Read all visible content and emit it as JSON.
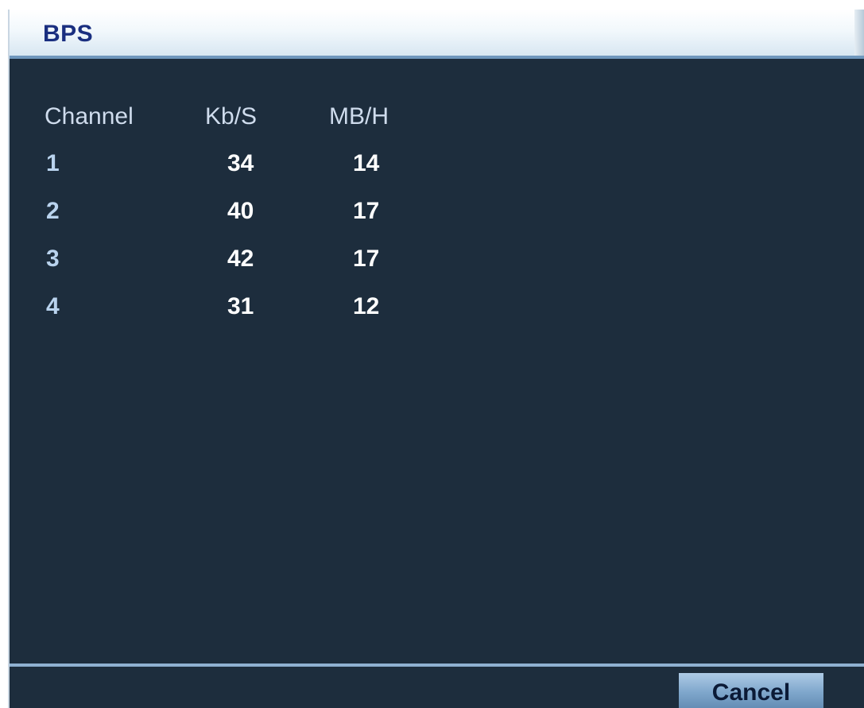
{
  "window": {
    "title": "BPS"
  },
  "table": {
    "headers": {
      "channel": "Channel",
      "kbs": "Kb/S",
      "mbh": "MB/H"
    },
    "rows": [
      {
        "channel": "1",
        "kbs": "34",
        "mbh": "14"
      },
      {
        "channel": "2",
        "kbs": "40",
        "mbh": "17"
      },
      {
        "channel": "3",
        "kbs": "42",
        "mbh": "17"
      },
      {
        "channel": "4",
        "kbs": "31",
        "mbh": "12"
      }
    ]
  },
  "footer": {
    "cancel_label": "Cancel"
  },
  "colors": {
    "background": "#1d2d3d",
    "title_text": "#1a2f80",
    "button": "#7fa7cc"
  }
}
